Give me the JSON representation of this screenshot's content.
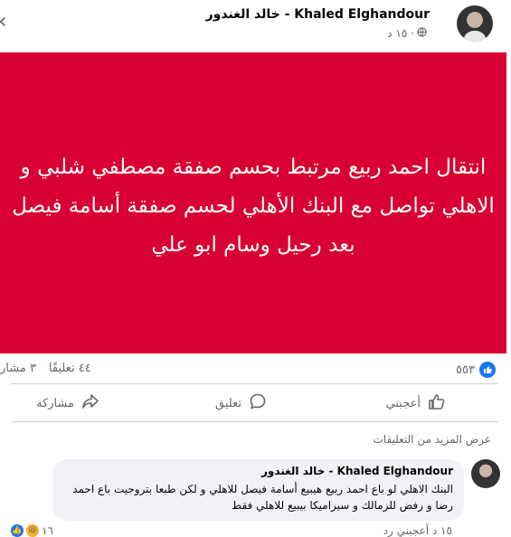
{
  "post": {
    "author": "خالد الغندور - Khaled Elghandour",
    "time": "١٥ د ·",
    "banner_text": "انتقال احمد ربيع مرتبط بحسم صفقة مصطفي شلبي و الاهلي تواصل مع البنك الأهلي لحسم صفقة أسامة فيصل بعد رحيل وسام ابو علي",
    "banner_color": "#d80032"
  },
  "stats": {
    "reactions_count": "٥٥٣",
    "comments": "٤٤ تعليقًا",
    "shares": "٣ مشار"
  },
  "actions": {
    "like": "أعجبني",
    "comment": "تعليق",
    "share": "مشاركة"
  },
  "comments_section": {
    "more_comments": "عرض المزيد من التعليقات",
    "comment": {
      "author": "خالد الغندور - Khaled Elghandour",
      "text": "البنك الاهلي لو باع احمد ربيع هيبيع أسامة فيصل للاهلي و لكن طبعا بتروجيت باع احمد رضا و رفض للزمالك و سيراميكا بيبيع للاهلي فقط",
      "reactions": "١٦",
      "footer_links": "١٥ د  أعجبني  رد"
    }
  },
  "accent": "#1877f2"
}
